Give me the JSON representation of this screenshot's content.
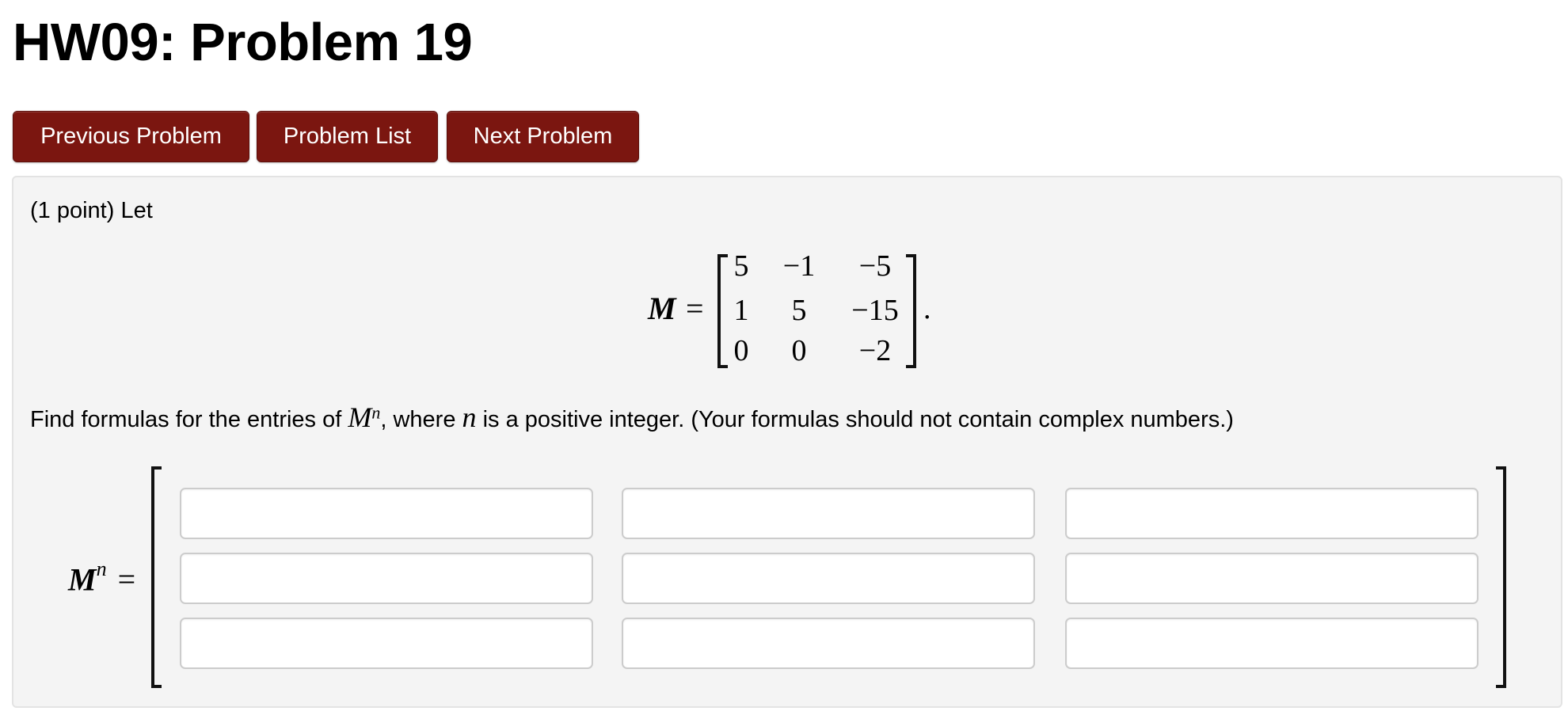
{
  "header": {
    "title": "HW09: Problem 19"
  },
  "nav": {
    "previous_label": "Previous Problem",
    "list_label": "Problem List",
    "next_label": "Next Problem",
    "button_color": "#7b1610"
  },
  "problem": {
    "intro": "(1 point) Let",
    "matrix_symbol": "M",
    "equals": "=",
    "matrix": [
      [
        "5",
        "−1",
        "−5"
      ],
      [
        "1",
        "5",
        "−15"
      ],
      [
        "0",
        "0",
        "−2"
      ]
    ],
    "matrix_period": ".",
    "find_prefix": "Find formulas for the entries of ",
    "find_symbol": "M",
    "find_exponent": "n",
    "find_middle": ", where ",
    "find_var": "n",
    "find_suffix": " is a positive integer. (Your formulas should not contain complex numbers.)",
    "answer_label_symbol": "M",
    "answer_label_exponent": "n",
    "answer_label_equals": "=",
    "answers": [
      [
        "",
        "",
        ""
      ],
      [
        "",
        "",
        ""
      ],
      [
        "",
        "",
        ""
      ]
    ]
  }
}
